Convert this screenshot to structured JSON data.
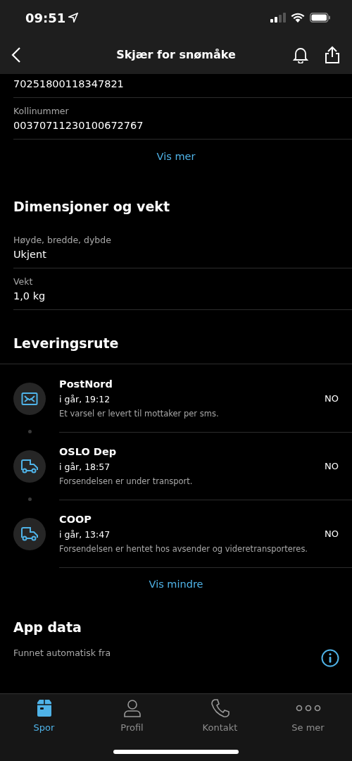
{
  "status_bar": {
    "time": "09:51"
  },
  "header": {
    "title": "Skjær for snømåke"
  },
  "shipment": {
    "fields": [
      {
        "value": "70251800118347821"
      },
      {
        "label": "Kollinummer",
        "value": "00370711230100672767"
      }
    ],
    "link": "Vis mer"
  },
  "dimensions": {
    "title": "Dimensjoner og vekt",
    "fields": [
      {
        "label": "Høyde, bredde, dybde",
        "value": "Ukjent"
      },
      {
        "label": "Vekt",
        "value": "1,0 kg"
      }
    ]
  },
  "route": {
    "title": "Leveringsrute",
    "events": [
      {
        "kind": "mail",
        "name": "PostNord",
        "time": "i går, 19:12",
        "description": "Et varsel er levert til mottaker per sms.",
        "country": "NO"
      },
      {
        "kind": "truck",
        "name": "OSLO Dep",
        "time": "i går, 18:57",
        "description": "Forsendelsen er under transport.",
        "country": "NO"
      },
      {
        "kind": "truck",
        "name": "COOP",
        "time": "i går, 13:47",
        "description": "Forsendelsen er hentet hos avsender og videretransporteres.",
        "country": "NO"
      }
    ],
    "link": "Vis mindre"
  },
  "app_data": {
    "title": "App data",
    "label": "Funnet automatisk fra"
  },
  "tabs": [
    {
      "kind": "package",
      "label": "Spor",
      "selected": true
    },
    {
      "kind": "person",
      "label": "Profil",
      "selected": false
    },
    {
      "kind": "phone",
      "label": "Kontakt",
      "selected": false
    },
    {
      "kind": "more",
      "label": "Se mer",
      "selected": false
    }
  ]
}
